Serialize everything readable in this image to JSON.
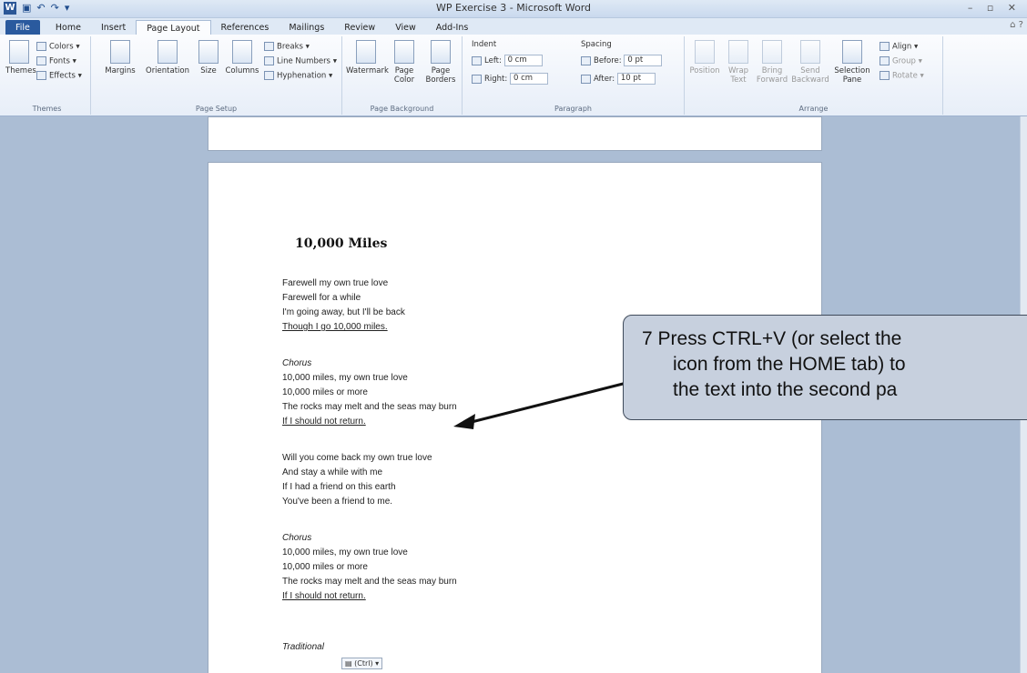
{
  "window": {
    "title": "WP Exercise 3 - Microsoft Word"
  },
  "tabs": [
    "File",
    "Home",
    "Insert",
    "Page Layout",
    "References",
    "Mailings",
    "Review",
    "View",
    "Add-Ins"
  ],
  "ribbon": {
    "themes": {
      "themes": "Themes",
      "colors": "Colors",
      "fonts": "Fonts",
      "effects": "Effects",
      "label": "Themes"
    },
    "page_setup": {
      "margins": "Margins",
      "orientation": "Orientation",
      "size": "Size",
      "columns": "Columns",
      "breaks": "Breaks",
      "line_numbers": "Line Numbers",
      "hyphenation": "Hyphenation",
      "label": "Page Setup"
    },
    "page_background": {
      "watermark": "Watermark",
      "page_color": "Page Color",
      "page_borders": "Page Borders",
      "label": "Page Background"
    },
    "paragraph": {
      "indent": "Indent",
      "left_label": "Left:",
      "left_value": "0 cm",
      "right_label": "Right:",
      "right_value": "0 cm",
      "spacing": "Spacing",
      "before_label": "Before:",
      "before_value": "0 pt",
      "after_label": "After:",
      "after_value": "10 pt",
      "label": "Paragraph"
    },
    "arrange": {
      "position": "Position",
      "wrap_text": "Wrap Text",
      "bring_forward": "Bring Forward",
      "send_backward": "Send Backward",
      "selection_pane": "Selection Pane",
      "align": "Align",
      "group": "Group",
      "rotate": "Rotate",
      "label": "Arrange"
    }
  },
  "document": {
    "title": "10,000 Miles",
    "lines": [
      {
        "text": "Farewell my own true love",
        "style": ""
      },
      {
        "text": "Farewell for a while",
        "style": ""
      },
      {
        "text": "I'm going away, but I'll be back",
        "style": ""
      },
      {
        "text": "Though I go 10,000 miles.",
        "style": "ul"
      },
      {
        "text": "Chorus",
        "style": "it"
      },
      {
        "text": "10,000 miles, my own true love",
        "style": ""
      },
      {
        "text": "10,000 miles or more",
        "style": ""
      },
      {
        "text": "The rocks may melt and the seas may burn",
        "style": ""
      },
      {
        "text": "If I should not return.",
        "style": "ul"
      },
      {
        "text": "Will you come back my own true love",
        "style": ""
      },
      {
        "text": "And stay a while with me",
        "style": ""
      },
      {
        "text": "If I had a friend on this earth",
        "style": ""
      },
      {
        "text": "You've been a friend to me.",
        "style": ""
      },
      {
        "text": "Chorus",
        "style": "it"
      },
      {
        "text": "10,000 miles, my own true love",
        "style": ""
      },
      {
        "text": "10,000 miles or more",
        "style": ""
      },
      {
        "text": "The rocks may melt and the seas may burn",
        "style": ""
      },
      {
        "text": "If I should not return.",
        "style": "ul"
      },
      {
        "text": "Traditional",
        "style": "it"
      }
    ],
    "paste_options": "(Ctrl) ▾"
  },
  "callout": {
    "line1": "7  Press CTRL+V (or select the",
    "line2": "icon from the HOME tab) to",
    "line3": "the text into the second pa"
  },
  "colors": {
    "accent": "#2a5a9e",
    "callout_bg": "#c7d0de"
  }
}
